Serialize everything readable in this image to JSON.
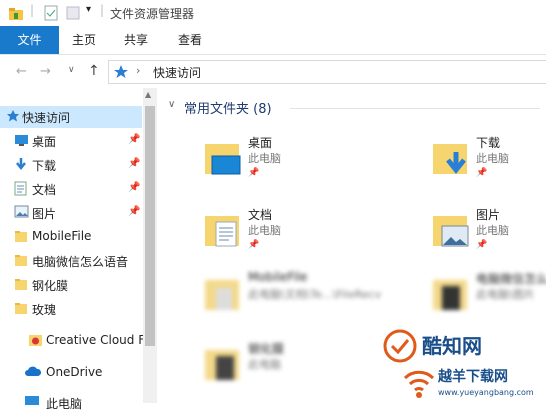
{
  "window": {
    "title": "文件资源管理器"
  },
  "ribbon": {
    "tabs": [
      "文件",
      "主页",
      "共享",
      "查看"
    ]
  },
  "address": {
    "path": "快速访问"
  },
  "nav": {
    "items": [
      {
        "label": "快速访问",
        "icon": "star-icon",
        "pinned": false
      },
      {
        "label": "桌面",
        "icon": "desktop-icon",
        "pinned": true
      },
      {
        "label": "下载",
        "icon": "download-icon",
        "pinned": true
      },
      {
        "label": "文档",
        "icon": "document-icon",
        "pinned": true
      },
      {
        "label": "图片",
        "icon": "picture-icon",
        "pinned": true
      },
      {
        "label": "MobileFile",
        "icon": "folder-icon",
        "pinned": false
      },
      {
        "label": "电脑微信怎么语音",
        "icon": "folder-icon",
        "pinned": false
      },
      {
        "label": "钢化膜",
        "icon": "folder-icon",
        "pinned": false
      },
      {
        "label": "玫瑰",
        "icon": "folder-icon",
        "pinned": false
      },
      {
        "label": "Creative Cloud F",
        "icon": "creative-cloud-icon",
        "pinned": false
      },
      {
        "label": "OneDrive",
        "icon": "onedrive-icon",
        "pinned": false
      },
      {
        "label": "此电脑",
        "icon": "pc-icon",
        "pinned": false
      }
    ]
  },
  "content": {
    "group_title": "常用文件夹 (8)",
    "tiles": [
      {
        "name": "桌面",
        "sub": "此电脑",
        "icon": "desktop-folder-icon"
      },
      {
        "name": "下载",
        "sub": "此电脑",
        "icon": "download-folder-icon"
      },
      {
        "name": "文档",
        "sub": "此电脑",
        "icon": "document-folder-icon"
      },
      {
        "name": "图片",
        "sub": "此电脑",
        "icon": "picture-folder-icon"
      },
      {
        "name": "MobileFile",
        "sub": "此电脑\\文档\\Te...\\FileRecv",
        "icon": "folder-icon"
      },
      {
        "name": "电脑微信怎么",
        "sub": "此电脑\\图片",
        "icon": "folder-icon"
      },
      {
        "name": "钢化膜",
        "sub": "此电脑",
        "icon": "folder-icon"
      }
    ]
  },
  "watermark": {
    "brand": "酷知网",
    "sub": "越羊下载网",
    "url": "www.yueyangbang.com"
  },
  "colors": {
    "accent": "#1979ca",
    "selected": "#cce8ff",
    "group_title": "#1e3a6e"
  }
}
